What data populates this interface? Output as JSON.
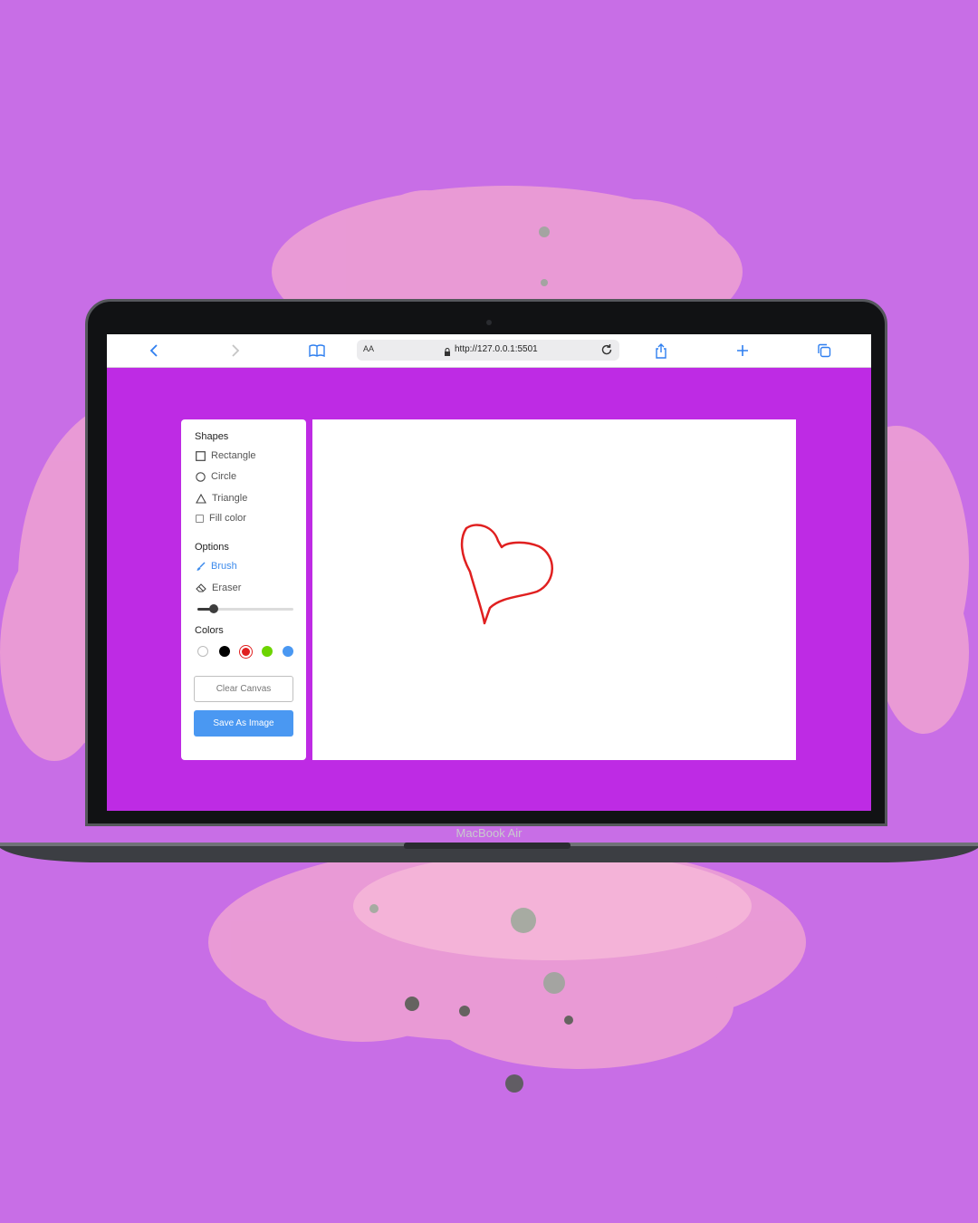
{
  "device": {
    "model_label": "MacBook Air"
  },
  "browser": {
    "text_size_label": "AA",
    "url": "http://127.0.0.1:5501",
    "icons": [
      "back-arrow-icon",
      "forward-arrow-icon",
      "bookmarks-book-icon",
      "lock-icon",
      "reload-icon",
      "share-icon",
      "new-tab-plus-icon",
      "tabs-overview-icon"
    ]
  },
  "tools": {
    "shapes_title": "Shapes",
    "shapes": [
      {
        "label": "Rectangle",
        "icon": "square-outline-icon"
      },
      {
        "label": "Circle",
        "icon": "circle-outline-icon"
      },
      {
        "label": "Triangle",
        "icon": "triangle-outline-icon"
      }
    ],
    "fill_color_label": "Fill color",
    "fill_color_checked": false,
    "options_title": "Options",
    "options": [
      {
        "label": "Brush",
        "icon": "brush-icon",
        "active": true
      },
      {
        "label": "Eraser",
        "icon": "eraser-icon",
        "active": false
      }
    ],
    "brush_size_fraction": 0.17,
    "colors_title": "Colors",
    "colors": [
      {
        "hex": "#ffffff",
        "selected": false
      },
      {
        "hex": "#000000",
        "selected": false
      },
      {
        "hex": "#e02020",
        "selected": true
      },
      {
        "hex": "#6dd400",
        "selected": false
      },
      {
        "hex": "#4a98f2",
        "selected": false
      }
    ],
    "clear_label": "Clear Canvas",
    "save_label": "Save As Image"
  },
  "canvas": {
    "stroke_color": "#e02020",
    "drawing": "heart-doodle"
  },
  "theme": {
    "page_bg": "#c86ee6",
    "screen_bg": "#be2be4",
    "accent": "#4a98f2"
  }
}
